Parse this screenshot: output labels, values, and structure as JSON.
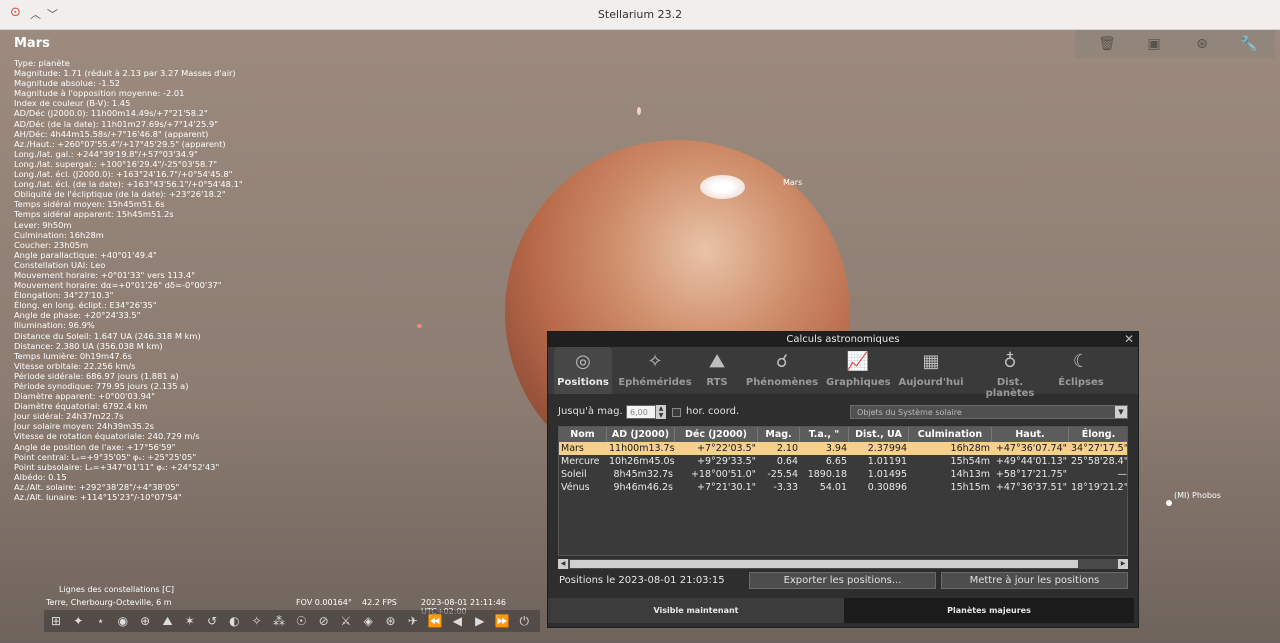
{
  "window": {
    "title": "Stellarium 23.2"
  },
  "sky": {
    "labels": {
      "mars": "Mars",
      "phobos": "(MI) Phobos"
    }
  },
  "info": {
    "name": "Mars",
    "lines": [
      "Type: planète",
      "Magnitude: 1.71 (réduit à 2.13 par 3.27 Masses d'air)",
      "Magnitude absolue: -1.52",
      "Magnitude à l'opposition moyenne: -2.01",
      "Index de couleur (B-V): 1.45",
      "AD/Déc (J2000.0): 11h00m14.49s/+7°21'58.2\"",
      "AD/Déc (de la date): 11h01m27.69s/+7°14'25.9\"",
      "AH/Déc: 4h44m15.58s/+7°16'46.8\" (apparent)",
      "Az./Haut.: +260°07'55.4\"/+17°45'29.5\" (apparent)",
      "Long./lat. gal.: +244°39'19.8\"/+57°03'34.9\"",
      "Long./lat. supergal.: +100°16'29.4\"/-25°03'58.7\"",
      "Long./lat. écl. (J2000.0): +163°24'16.7\"/+0°54'45.8\"",
      "Long./lat. écl. (de la date): +163°43'56.1\"/+0°54'48.1\"",
      "Obliquité de l'écliptique (de la date): +23°26'18.2\"",
      "Temps sidéral moyen: 15h45m51.6s",
      "Temps sidéral apparent: 15h45m51.2s",
      "Lever: 9h50m",
      "Culmination: 16h28m",
      "Coucher: 23h05m",
      "Angle parallactique: +40°01'49.4\"",
      "Constellation UAI: Leo",
      "Mouvement horaire: +0°01'33\" vers 113.4°",
      "Mouvement horaire: dα=+0°01'26\" dδ=-0°00'37\"",
      "Élongation: 34°27'10.3\"",
      "Élong. en long. éclipt.: E34°26'35\"",
      "Angle de phase: +20°24'33.5\"",
      "Illumination: 96.9%",
      "Distance du Soleil: 1.647 UA (246.318 M km)",
      "Distance: 2.380 UA (356.038 M km)",
      "Temps lumière: 0h19m47.6s",
      "Vitesse orbitale: 22.256 km/s",
      "Période sidérale: 686.97 jours (1.881 a)",
      "Période synodique: 779.95 jours (2.135 a)",
      "Diamètre apparent: +0°00'03.94\"",
      "Diamètre équatorial: 6792.4 km",
      "Jour sidéral: 24h37m22.7s",
      "Jour solaire moyen: 24h39m35.2s",
      "Vitesse de rotation équatoriale: 240.729 m/s",
      "Angle de position de l'axe: +17°56'59\"",
      "Point central: Lₑ=+9°35'05\" φₑ: +25°25'05\"",
      "Point subsolaire: Lₛ=+347°01'11\" φₛ: +24°52'43\"",
      "Albédo: 0.15",
      "Az./Alt. solaire: +292°38'28\"/+4°38'05\"",
      "Az./Alt. lunaire: +114°15'23\"/-10°07'54\""
    ]
  },
  "status": {
    "constellation_lines": "Lignes des constellations  [C]",
    "location": "Terre, Cherbourg-Octeville, 6 m",
    "fov": "FOV 0.00164°",
    "fps": "42.2 FPS",
    "datetime": "2023-08-01 21:11:46 UTC+02:00"
  },
  "dialog": {
    "title": "Calculs astronomiques",
    "tabs": [
      "Positions",
      "Ephémérides",
      "RTS",
      "Phénomènes",
      "Graphiques",
      "Aujourd'hui",
      "Dist. planètes",
      "Éclipses"
    ],
    "mag_label": "Jusqu'à mag. :",
    "mag_value": "6,00",
    "hor_coord": "hor. coord.",
    "object_select": "Objets du Système solaire",
    "columns": [
      "Nom",
      "AD (J2000)",
      "Déc (J2000)",
      "Mag.",
      "T.a., \"",
      "Dist., UA",
      "Culmination",
      "Haut.",
      "Élong."
    ],
    "rows": [
      [
        "Mars",
        "11h00m13.7s",
        "+7°22'03.5\"",
        "2.10",
        "3.94",
        "2.37994",
        "16h28m",
        "+47°36'07.74\"",
        "34°27'17.5\""
      ],
      [
        "Mercure",
        "10h26m45.0s",
        "+9°29'33.5\"",
        "0.64",
        "6.65",
        "1.01191",
        "15h54m",
        "+49°44'01.13\"",
        "25°58'28.4\""
      ],
      [
        "Soleil",
        "8h45m32.7s",
        "+18°00'51.0\"",
        "-25.54",
        "1890.18",
        "1.01495",
        "14h13m",
        "+58°17'21.75\"",
        "—"
      ],
      [
        "Vénus",
        "9h46m46.2s",
        "+7°21'30.1\"",
        "-3.33",
        "54.01",
        "0.30896",
        "15h15m",
        "+47°36'37.51\"",
        "18°19'21.2\""
      ]
    ],
    "positions_at": "Positions le 2023-08-01 21:03:15",
    "export_btn": "Exporter les positions...",
    "update_btn": "Mettre à jour les positions",
    "footer_tabs": [
      "Visible maintenant",
      "Planètes majeures"
    ]
  },
  "colors": {
    "selected_row": "#f4d08a",
    "dialog_bg": "#2e2e2e"
  }
}
